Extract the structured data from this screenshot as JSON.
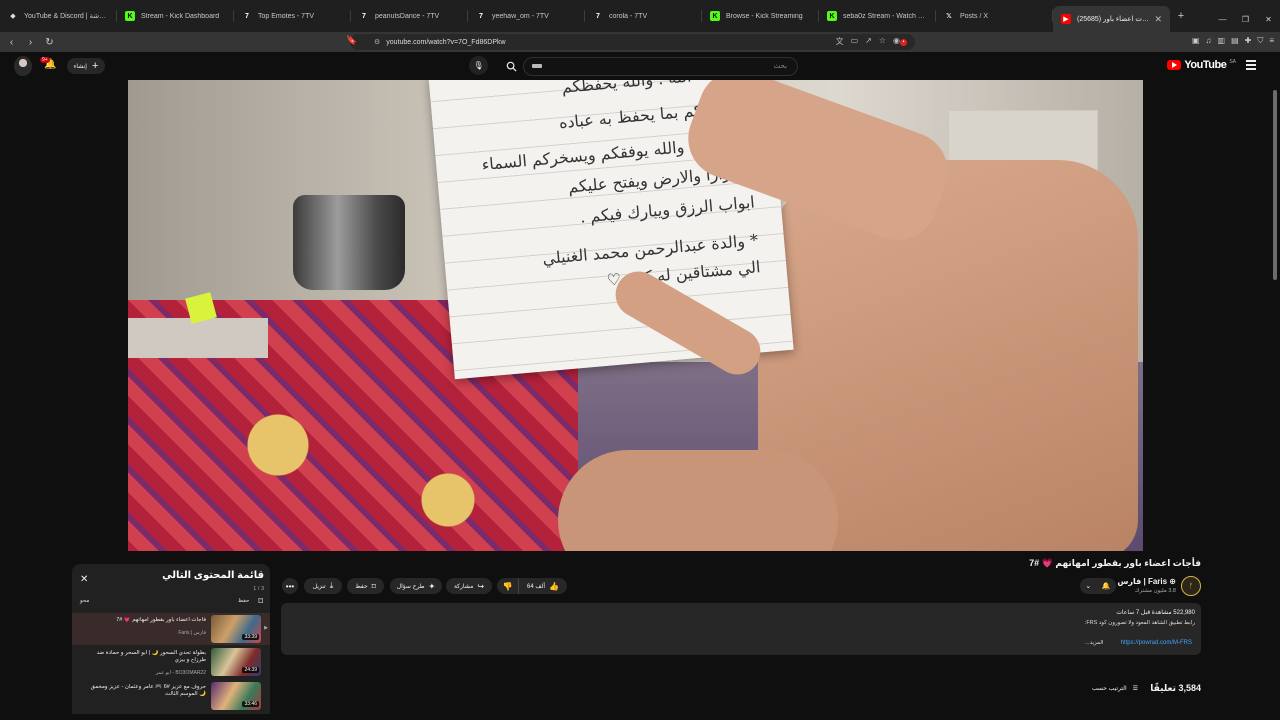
{
  "browser": {
    "tabs": [
      {
        "label": "YouTube & Discord | يوت الدردشة",
        "icon": "music-note-icon"
      },
      {
        "label": "Stream - Kick Dashboard",
        "icon": "kick-icon"
      },
      {
        "label": "Top Emotes - 7TV",
        "icon": "7tv-icon"
      },
      {
        "label": "peanutsDance - 7TV",
        "icon": "7tv-icon"
      },
      {
        "label": "yeehaw_om - 7TV",
        "icon": "7tv-icon"
      },
      {
        "label": "corola - 7TV",
        "icon": "7tv-icon"
      },
      {
        "label": "Browse - Kick Streaming",
        "icon": "kick-icon"
      },
      {
        "label": "seba0z Stream - Watch Live on Ki…",
        "icon": "kick-icon"
      },
      {
        "label": "Posts / X",
        "icon": "x-icon"
      },
      {
        "label": "(25685) فأجات اعضاء باور …",
        "icon": "youtube-icon",
        "active": true
      }
    ],
    "url": "youtube.com/watch?v=7O_Fd86DPkw"
  },
  "youtube": {
    "logo_text": "YouTube",
    "logo_country": "SA",
    "search_placeholder": "بحث",
    "create_label": "إنشاء",
    "notification_count": "9+"
  },
  "video": {
    "note_lines": [
      "إن شاء الله . والله يحفظكم",
      "ويحفظكم بما يحفظ به عباده",
      "الصالحين والله يوفقكم ويسخركم السماء",
      "ميدرارا والارض ويفتح عليكم",
      "ابواب الرزق ويبارك فيكم .",
      "* والدة عبدالرحمن محمد الغنيلي",
      "الي مشتاقين له كثير ♡"
    ],
    "title": "فأجات اعضاء باور بقطور امهاتهم 💗 #7",
    "channel_name": "فارس | Faris ⊕",
    "channel_subs": "3.8 مليون مشترك",
    "like_count": "64 ألف",
    "share_label": "مشاركة",
    "ask_label": "طرح سؤال",
    "save_label": "حفظ",
    "download_label": "تنزيل",
    "views_line": "522,980 مشاهدة قبل 7 ساعات",
    "desc_line": "رابط تطبيق الشاهد المعود ولا تصورون كود FRS:",
    "desc_link": "https://powrad.com/M-FRS",
    "desc_more": "...المزيد",
    "comments_count": "3,584 تعليقًا",
    "sort_label": "الترتيب حسب"
  },
  "queue": {
    "title": "قائمة المحتوى التالي",
    "position": "1 / 3",
    "save_label": "حفظ",
    "other_label": "محو",
    "items": [
      {
        "title": "فأجات اعضاء باور بقطور امهاتهم 💗 #7",
        "channel": "فارس | Faris",
        "duration": "33:39",
        "playing": true
      },
      {
        "title": "بطولة تحدي السحور 🌙 | ابو السحر و حمادة ضد طرزاح و بيزي",
        "channel": "BO3OMAR22 - ابو عمر",
        "duration": "24:39",
        "playing": false
      },
      {
        "title": "حروف مع عزيز #6 🎮 عامر وعثمان - عزيز ومخمق 🌙 الموسم الثالث",
        "channel": "",
        "duration": "33:46",
        "playing": false
      }
    ]
  }
}
